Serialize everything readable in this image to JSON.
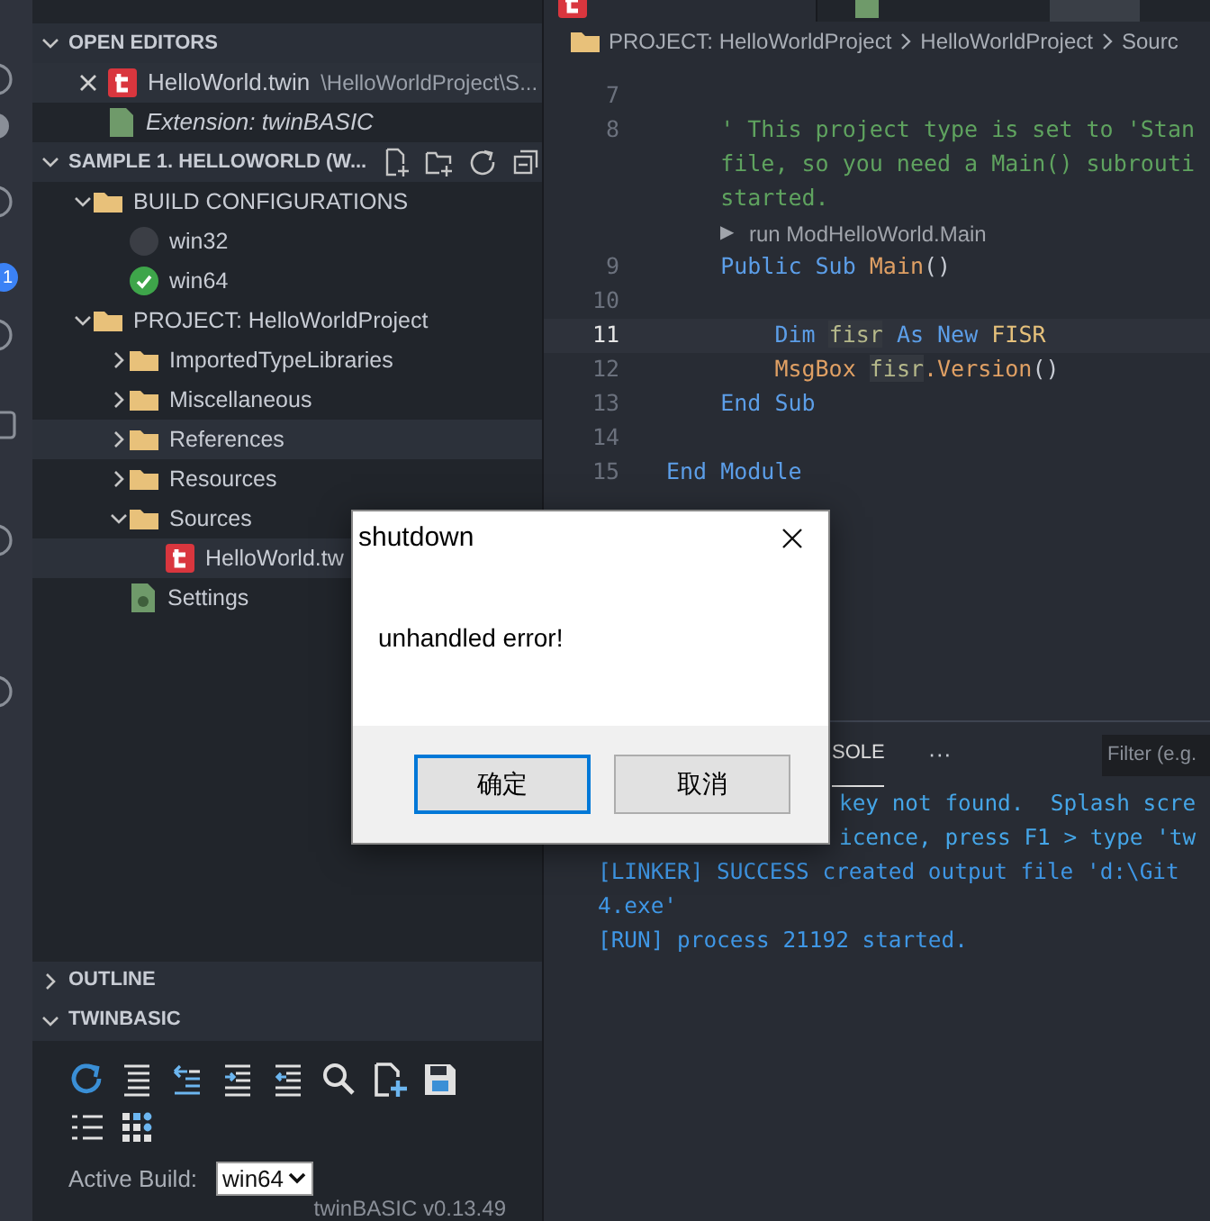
{
  "activity_bar": {
    "badge": "1"
  },
  "open_editors": {
    "title": "OPEN EDITORS",
    "expanded": true,
    "items": [
      {
        "name": "HelloWorld.twin",
        "path": "\\HelloWorldProject\\S...",
        "kind": "twin",
        "closable": true,
        "hovered": true
      },
      {
        "name": "Extension: twinBASIC",
        "kind": "extension",
        "closable": false,
        "hovered": false
      }
    ]
  },
  "explorer": {
    "title": "SAMPLE 1. HELLOWORLD (W...",
    "expanded": true,
    "tree": [
      {
        "label": "BUILD CONFIGURATIONS",
        "kind": "folder",
        "expanded": true,
        "highlighted": false,
        "children": [
          {
            "label": "win32",
            "kind": "config",
            "checked": false,
            "highlighted": false
          },
          {
            "label": "win64",
            "kind": "config",
            "checked": true,
            "highlighted": false
          }
        ]
      },
      {
        "label": "PROJECT: HelloWorldProject",
        "kind": "folder",
        "expanded": true,
        "highlighted": false,
        "children": [
          {
            "label": "ImportedTypeLibraries",
            "kind": "folder",
            "expanded": false,
            "highlighted": false
          },
          {
            "label": "Miscellaneous",
            "kind": "folder",
            "expanded": false,
            "highlighted": false
          },
          {
            "label": "References",
            "kind": "folder",
            "expanded": false,
            "highlighted": true
          },
          {
            "label": "Resources",
            "kind": "folder",
            "expanded": false,
            "highlighted": false
          },
          {
            "label": "Sources",
            "kind": "folder",
            "expanded": true,
            "highlighted": false,
            "children": [
              {
                "label": "HelloWorld.tw",
                "kind": "twin",
                "highlighted": true
              }
            ]
          },
          {
            "label": "Settings",
            "kind": "settings",
            "highlighted": false
          }
        ]
      }
    ]
  },
  "outline": {
    "title": "OUTLINE",
    "expanded": false
  },
  "twinbasic": {
    "title": "TWINBASIC",
    "expanded": true,
    "active_build_label": "Active Build:",
    "active_build": "win64",
    "version": "twinBASIC v0.13.49"
  },
  "breadcrumb": [
    "PROJECT: HelloWorldProject",
    "HelloWorldProject",
    "Sourc"
  ],
  "code": [
    {
      "kind": "line",
      "number": "7",
      "current": false
    },
    {
      "kind": "line",
      "number": "8",
      "current": false,
      "tokens": [
        {
          "text": "    ' This project type is set to 'Stan",
          "kind": "comment"
        }
      ]
    },
    {
      "kind": "wrap",
      "tokens": [
        {
          "text": "    file, so you need a Main() subrouti",
          "kind": "comment"
        }
      ]
    },
    {
      "kind": "wrap",
      "tokens": [
        {
          "text": "    started.",
          "kind": "comment"
        }
      ]
    },
    {
      "kind": "codelens",
      "icon": "▶",
      "text": "run ModHelloWorld.Main"
    },
    {
      "kind": "line",
      "number": "9",
      "current": false,
      "tokens": [
        {
          "text": "    Public Sub ",
          "kind": "keyword"
        },
        {
          "text": "Main",
          "kind": "function"
        },
        {
          "text": "()",
          "kind": "punct"
        }
      ]
    },
    {
      "kind": "line",
      "number": "10",
      "current": false
    },
    {
      "kind": "line",
      "number": "11",
      "current": true,
      "tokens": [
        {
          "text": "        Dim ",
          "kind": "keyword"
        },
        {
          "text": "fisr",
          "kind": "variable"
        },
        {
          "text": " As New ",
          "kind": "keyword"
        },
        {
          "text": "FISR",
          "kind": "type"
        }
      ]
    },
    {
      "kind": "line",
      "number": "12",
      "current": false,
      "tokens": [
        {
          "text": "        MsgBox ",
          "kind": "function"
        },
        {
          "text": "fisr",
          "kind": "variable"
        },
        {
          "text": ".Version",
          "kind": "function"
        },
        {
          "text": "()",
          "kind": "punct"
        }
      ]
    },
    {
      "kind": "line",
      "number": "13",
      "current": false,
      "tokens": [
        {
          "text": "    End Sub",
          "kind": "keyword"
        }
      ]
    },
    {
      "kind": "line",
      "number": "14",
      "current": false
    },
    {
      "kind": "line",
      "number": "15",
      "current": false,
      "tokens": [
        {
          "text": "End Module",
          "kind": "keyword"
        }
      ]
    }
  ],
  "panel": {
    "tab": "SOLE",
    "tab_selected": true,
    "more": "···",
    "filter_placeholder": "Filter (e.g.",
    "output": [
      {
        "text": "key not found.  Splash scre",
        "clipped": true
      },
      {
        "text": "icence, press F1 > type 'tw",
        "clipped": true
      },
      {
        "text": "[LINKER] SUCCESS created output file 'd:\\Git",
        "clipped": false
      },
      {
        "text": "4.exe'",
        "clipped": false
      },
      {
        "text": "[RUN] process 21192 started.",
        "clipped": false
      }
    ]
  },
  "dialog": {
    "title": "shutdown",
    "message": "unhandled error!",
    "buttons": [
      {
        "label": "确定",
        "focused": true
      },
      {
        "label": "取消",
        "focused": false
      }
    ]
  }
}
